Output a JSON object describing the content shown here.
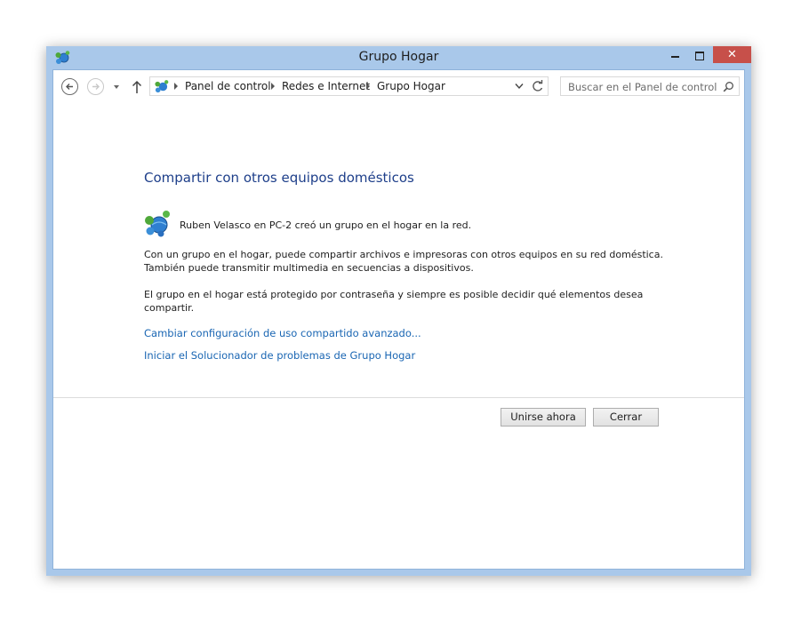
{
  "window": {
    "title": "Grupo Hogar",
    "close_glyph": "✕",
    "app_icon": "homegroup-icon"
  },
  "navbar": {
    "breadcrumbs": [
      "Panel de control",
      "Redes e Internet",
      "Grupo Hogar"
    ],
    "search_placeholder": "Buscar en el Panel de control"
  },
  "content": {
    "heading": "Compartir con otros equipos domésticos",
    "creator_message": "Ruben Velasco en PC-2 creó un grupo en el hogar en la red.",
    "paragraph1_line1": "Con un grupo en el hogar, puede compartir archivos e impresoras con otros equipos en su red doméstica.",
    "paragraph1_line2": "También puede transmitir multimedia en secuencias a dispositivos.",
    "paragraph2_line1": "El grupo en el hogar está protegido por contraseña y siempre es posible decidir qué elementos desea",
    "paragraph2_line2": "compartir.",
    "link_advanced": "Cambiar configuración de uso compartido avanzado...",
    "link_troubleshooter": "Iniciar el Solucionador de problemas de Grupo Hogar"
  },
  "buttons": {
    "join": "Unirse ahora",
    "close": "Cerrar"
  },
  "colors": {
    "frame": "#a9c8ea",
    "close_button": "#c7504a",
    "heading": "#1e3f8a",
    "link": "#1a66b3"
  }
}
